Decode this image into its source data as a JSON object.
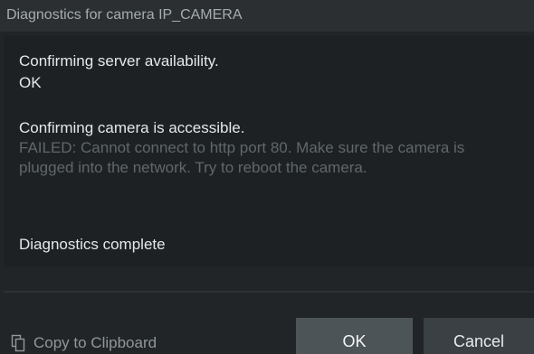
{
  "dialog": {
    "title": "Diagnostics for camera IP_CAMERA"
  },
  "log": {
    "entries": [
      {
        "text": "Confirming server availability.",
        "kind": "step"
      },
      {
        "text": "OK",
        "kind": "ok"
      },
      {
        "text": "Confirming camera is accessible.",
        "kind": "step"
      },
      {
        "text": "FAILED: Cannot connect to http port 80. Make sure the camera is plugged into the network. Try to reboot the camera.",
        "kind": "failed"
      },
      {
        "text": "Diagnostics complete",
        "kind": "step"
      }
    ]
  },
  "footer": {
    "copy_label": "Copy to Clipboard",
    "copy_icon": "clipboard-copy-icon",
    "ok_label": "OK",
    "cancel_label": "Cancel"
  },
  "colors": {
    "background": "#222527",
    "text": "#e4e8ea",
    "failed_text": "#5f676b",
    "ok_button": "#4d5457",
    "cancel_button": "#3a4044"
  }
}
